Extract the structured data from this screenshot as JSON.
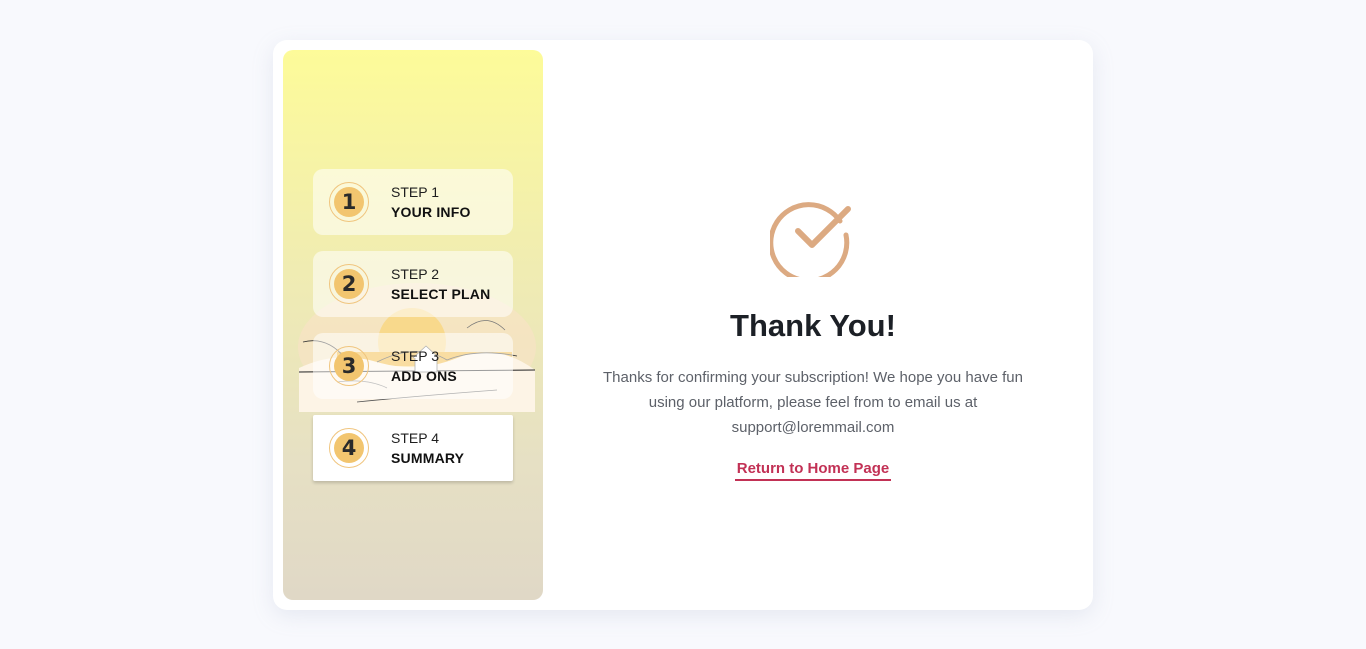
{
  "sidebar": {
    "steps": [
      {
        "number": "1",
        "step_label": "STEP 1",
        "title": "YOUR INFO",
        "active": false
      },
      {
        "number": "2",
        "step_label": "STEP 2",
        "title": "SELECT PLAN",
        "active": false
      },
      {
        "number": "3",
        "step_label": "STEP 3",
        "title": "ADD ONS",
        "active": false
      },
      {
        "number": "4",
        "step_label": "STEP 4",
        "title": "SUMMARY",
        "active": true
      }
    ],
    "illustration": "sunset-landscape-illustration"
  },
  "main": {
    "icon": "check-circle-icon",
    "title": "Thank You!",
    "message": "Thanks for confirming your subscription! We hope you have fun using our platform, please feel from to email us at support@loremmail.com",
    "link_label": "Return to Home Page"
  },
  "colors": {
    "accent": "#c23155",
    "badge": "#f2c56f",
    "check": "#dcaa82",
    "title": "#1c2026"
  }
}
